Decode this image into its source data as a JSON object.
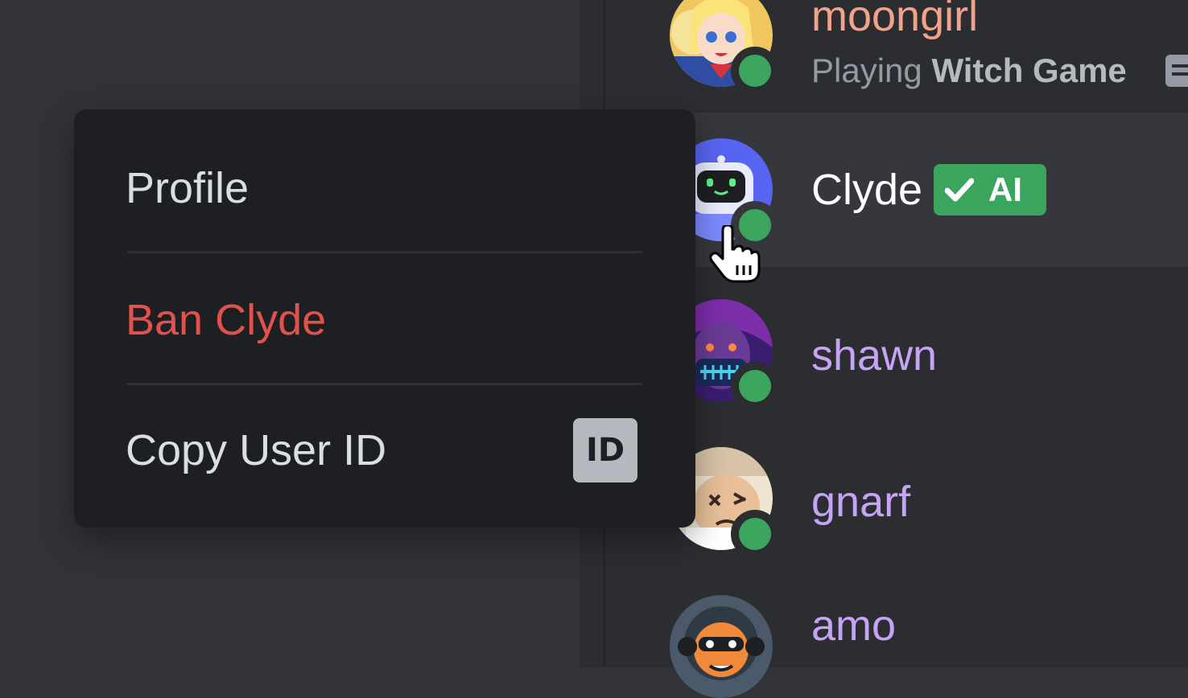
{
  "members": [
    {
      "name": "moongirl",
      "name_color": "#f2a28a",
      "activity_prefix": "Playing",
      "activity_name": "Witch Game",
      "icon": "rich-presence-icon"
    },
    {
      "name": "Clyde",
      "name_color": "#ffffff",
      "badge": {
        "label": "AI",
        "icon": "checkmark-icon",
        "color": "#3ba55d"
      }
    },
    {
      "name": "shawn",
      "name_color": "#c5a3f5"
    },
    {
      "name": "gnarf",
      "name_color": "#c5a3f5"
    },
    {
      "name": "amo",
      "name_color": "#c5a3f5"
    }
  ],
  "context_menu": {
    "items": [
      {
        "label": "Profile",
        "style": "normal"
      },
      {
        "label": "Ban Clyde",
        "style": "danger",
        "color": "#e0534d"
      },
      {
        "label": "Copy User ID",
        "style": "normal",
        "icon": "id-icon",
        "icon_text": "ID"
      }
    ]
  },
  "status_color": "#3ba55d"
}
